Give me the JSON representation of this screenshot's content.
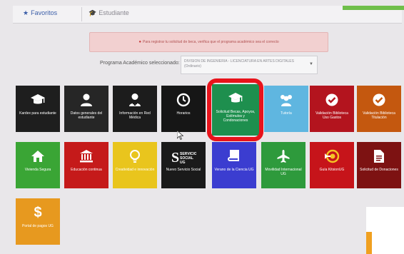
{
  "tabs": [
    {
      "label": "Favoritos",
      "icon": "star-icon",
      "color": "#3b5ea8"
    },
    {
      "label": "Estudiante",
      "icon": "graduation-cap-icon",
      "color": "#8a8890"
    }
  ],
  "alert": {
    "text": "Para registrar tu solicitud de beca, verifica que el programa académico sea el correcto",
    "color": "#f2d0d0"
  },
  "program": {
    "label": "Programa Académico seleccionado:",
    "value": "DIVISION DE INGENIERIA - LICENCIATURA EN ARTES DIGITALES (Ordinario)"
  },
  "tiles": [
    {
      "label": "Kardex para estudiante",
      "color": "#1e1e1e",
      "icon": "graduation-cap-icon"
    },
    {
      "label": "Datos generales del estudiante",
      "color": "#262626",
      "icon": "user-icon"
    },
    {
      "label": "Información en Red Médica",
      "color": "#1c1c1c",
      "icon": "medical-user-icon"
    },
    {
      "label": "Horarios",
      "color": "#161616",
      "icon": "clock-icon"
    },
    {
      "label": "Solicitud Becas, Apoyos, Estímulos y Condonaciones",
      "color": "#1e8f4e",
      "icon": "graduation-cap-icon"
    },
    {
      "label": "Tutoría",
      "color": "#5fb6e0",
      "icon": "group-icon"
    },
    {
      "label": "Validación Biblioteca Uso Gastos",
      "color": "#b3141e",
      "icon": "check-circle-icon"
    },
    {
      "label": "Validación Biblioteca Titulación",
      "color": "#c4580f",
      "icon": "check-circle-icon"
    },
    {
      "label": "Vivienda Segura",
      "color": "#3aa535",
      "icon": "home-icon"
    },
    {
      "label": "Educación continua",
      "color": "#c51a1a",
      "icon": "institution-icon"
    },
    {
      "label": "Creatividad e innovación",
      "color": "#e9c51d",
      "icon": "lightbulb-icon"
    },
    {
      "label": "Nuevo Servicio Social",
      "color": "#1a1a1a",
      "icon": "servicio-social-logo",
      "logo_text": "SERVICIO SOCIAL UG"
    },
    {
      "label": "Verano de la Ciencia UG",
      "color": "#3b3dd0",
      "icon": "book-icon"
    },
    {
      "label": "Movilidad Internacional UG",
      "color": "#2e9a3c",
      "icon": "airplane-icon"
    },
    {
      "label": "Guía KitsionUG",
      "color": "#c6141a",
      "icon": "target-arrow-icon"
    },
    {
      "label": "Solicitud de Donaciones",
      "color": "#7d1212",
      "icon": "document-icon"
    },
    {
      "label": "Portal de pagos UG",
      "color": "#e7991f",
      "icon": "dollar-icon"
    }
  ]
}
